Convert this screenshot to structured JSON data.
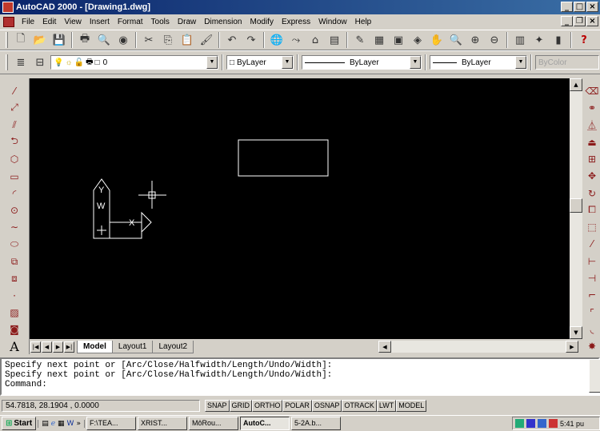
{
  "window": {
    "title": "AutoCAD 2000 - [Drawing1.dwg]",
    "min": "_",
    "max": "□",
    "close": "×"
  },
  "menu": [
    "File",
    "Edit",
    "View",
    "Insert",
    "Format",
    "Tools",
    "Draw",
    "Dimension",
    "Modify",
    "Express",
    "Window",
    "Help"
  ],
  "mdi": {
    "min": "_",
    "restore": "❐",
    "close": "×"
  },
  "properties": {
    "layer": "0",
    "color": "ByLayer",
    "linetype": "ByLayer",
    "lineweight": "ByLayer",
    "plotstyle": "ByColor"
  },
  "tabs": [
    "Model",
    "Layout1",
    "Layout2"
  ],
  "command": {
    "history": [
      "Specify next point or [Arc/Close/Halfwidth/Length/Undo/Width]:",
      "Specify next point or [Arc/Close/Halfwidth/Length/Undo/Width]:"
    ],
    "prompt": "Command:"
  },
  "status": {
    "coords": "54.7818, 28.1904 , 0.0000",
    "toggles": [
      "SNAP",
      "GRID",
      "ORTHO",
      "POLAR",
      "OSNAP",
      "OTRACK",
      "LWT",
      "MODEL"
    ]
  },
  "ucs": {
    "x": "X",
    "y": "Y",
    "w": "W"
  },
  "taskbar": {
    "start": "Start",
    "tasks": [
      "F:\\TEA...",
      "XRIST...",
      "MôRou...",
      "AutoC...",
      "5-2A.b..."
    ],
    "clock": "5:41 pu"
  },
  "colors": {
    "title_start": "#0a246a",
    "title_end": "#3a6ea5",
    "canvas": "#000000",
    "drawing": "#ffffff"
  }
}
